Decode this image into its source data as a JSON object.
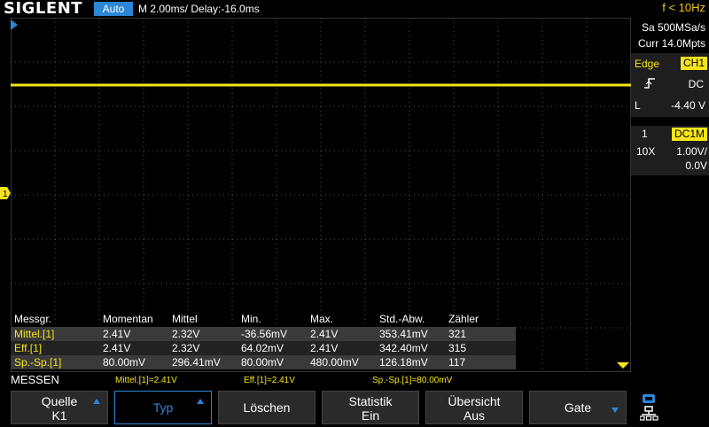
{
  "header": {
    "logo": "SIGLENT",
    "mode": "Auto",
    "timebase": "M 2.00ms/ Delay:-16.0ms",
    "frequency": "f < 10Hz"
  },
  "acquisition": {
    "sample_rate": "Sa 500MSa/s",
    "memory": "Curr 14.0Mpts"
  },
  "trigger": {
    "type_label": "Edge",
    "source": "CH1",
    "coupling": "DC",
    "level_label": "L",
    "level": "-4.40 V"
  },
  "channel1": {
    "number": "1",
    "coupling": "DC1M",
    "probe": "10X",
    "scale": "1.00V/",
    "offset": "0.0V",
    "marker": "1",
    "color": "#f5e51a"
  },
  "measurements": {
    "headers": [
      "Messgr.",
      "Momentan",
      "Mittel",
      "Min.",
      "Max.",
      "Std.-Abw.",
      "Zähler"
    ],
    "rows": [
      [
        "Mittel.[1]",
        "2.41V",
        "2.32V",
        "-36.56mV",
        "2.41V",
        "353.41mV",
        "321"
      ],
      [
        "Eff.[1]",
        "2.41V",
        "2.32V",
        "64.02mV",
        "2.41V",
        "342.40mV",
        "315"
      ],
      [
        "Sp.-Sp.[1]",
        "80.00mV",
        "296.41mV",
        "80.00mV",
        "480.00mV",
        "126.18mV",
        "117"
      ]
    ]
  },
  "menu_title": "MESSEN",
  "summary": {
    "mean": "Mittel.[1]=2.41V",
    "rms": "Eff.[1]=2.41V",
    "pkpk": "Sp.-Sp.[1]=80.00mV"
  },
  "softkeys": {
    "source_line1": "Quelle",
    "source_line2": "K1",
    "type": "Typ",
    "clear": "Löschen",
    "stats_line1": "Statistik",
    "stats_line2": "Ein",
    "overview_line1": "Übersicht",
    "overview_line2": "Aus",
    "gate": "Gate"
  },
  "trace": {
    "level_fraction_from_top": 0.19
  },
  "colors": {
    "accent": "#2b86d6",
    "trace": "#f5e51a",
    "frequency": "#f5c518"
  }
}
